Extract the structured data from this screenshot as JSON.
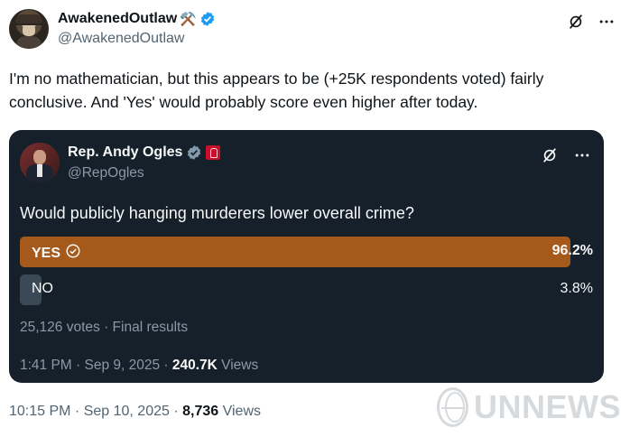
{
  "author": {
    "display_name": "AwakenedOutlaw",
    "emoji": "⚒️",
    "handle": "@AwakenedOutlaw"
  },
  "tweet": {
    "text": "I'm no mathematician, but this appears to be (+25K respondents voted) fairly conclusive.  And 'Yes' would probably score even higher after today.",
    "time": "10:15 PM · Sep 10, 2025 · ",
    "views_count": "8,736",
    "views_label": " Views"
  },
  "quoted": {
    "display_name": "Rep. Andy Ogles",
    "handle": "@RepOgles",
    "question": "Would publicly hanging murderers lower overall crime?",
    "options": [
      {
        "label": "YES",
        "percent": "96.2%",
        "value": 96.2,
        "selected": true
      },
      {
        "label": "NO",
        "percent": "3.8%",
        "value": 3.8,
        "selected": false
      }
    ],
    "results": "25,126 votes · Final results",
    "time": "1:41 PM · Sep 9, 2025 · ",
    "views_count": "240.7K",
    "views_label": " Views"
  },
  "watermark": {
    "text": "UNNEWS"
  },
  "colors": {
    "card_bg": "#15202b",
    "yes_bar": "#a55a1b",
    "no_bar": "#3b4957",
    "verified": "#1d9bf0"
  }
}
